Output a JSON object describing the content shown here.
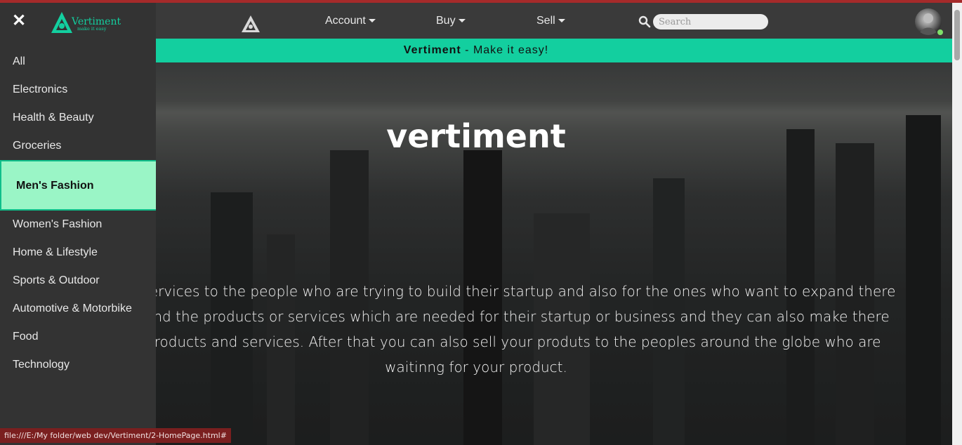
{
  "navbar": {
    "menus": [
      {
        "label": "Account"
      },
      {
        "label": "Buy"
      },
      {
        "label": "Sell"
      }
    ],
    "search": {
      "placeholder": "Search"
    },
    "logo_icon": "vertiment-triangle-logo",
    "avatar_icon": "user-avatar",
    "status_color": "#7fe06a"
  },
  "banner": {
    "brand": "Vertiment",
    "tagline": " - Make it easy!",
    "color": "#13cf9f"
  },
  "hero": {
    "title": "vertiment",
    "text": "is providing services to the people who are trying to build their startup and also for the ones who want to expand there people can find the products or services which are needed for their startup or business and they can also make there own g our products and services. After that you can also sell your produts to the peoples around the globe who are waitinng for your product."
  },
  "sidebar": {
    "close_icon": "close-icon",
    "logo": {
      "name": "Vertiment",
      "tagline": "make it easy"
    },
    "items": [
      {
        "label": "All"
      },
      {
        "label": "Electronics"
      },
      {
        "label": "Health & Beauty"
      },
      {
        "label": "Groceries"
      },
      {
        "label": "Men's Fashion",
        "active": true
      },
      {
        "label": "Women's Fashion"
      },
      {
        "label": "Home & Lifestyle"
      },
      {
        "label": "Sports & Outdoor"
      },
      {
        "label": "Automotive & Motorbike"
      },
      {
        "label": "Food"
      },
      {
        "label": "Technology"
      }
    ],
    "active_color": "#9af5c6"
  },
  "status_bar": {
    "url": "file:///E:/My folder/web dev/Vertiment/2-HomePage.html#"
  }
}
